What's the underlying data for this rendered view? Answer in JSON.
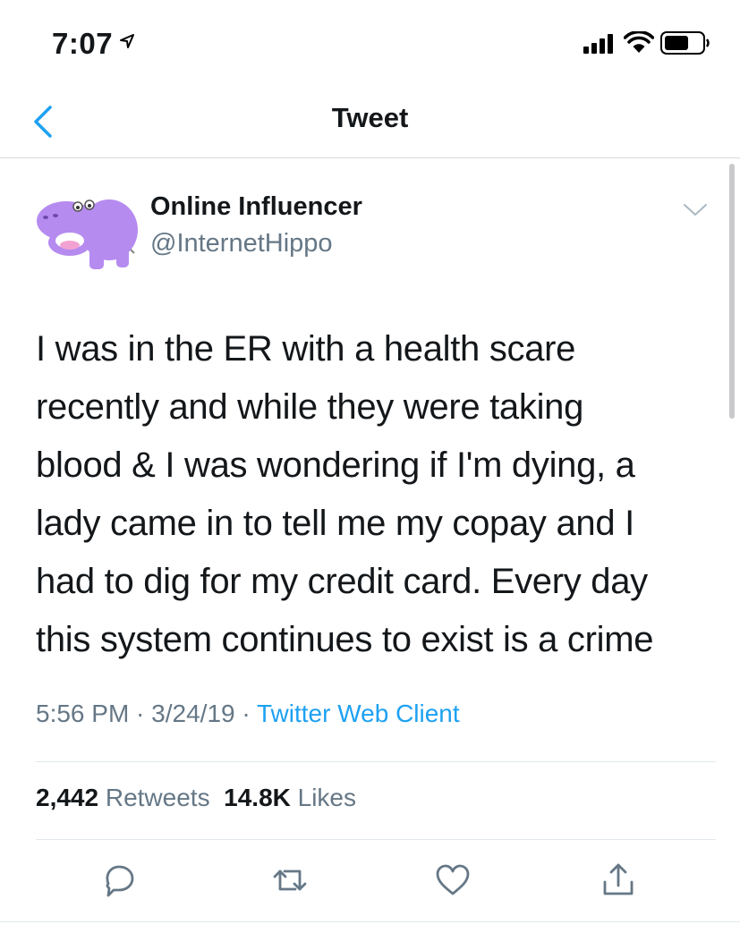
{
  "status_bar": {
    "time": "7:07"
  },
  "nav": {
    "title": "Tweet"
  },
  "author": {
    "name": "Online Influencer",
    "handle": "@InternetHippo"
  },
  "tweet": {
    "text": "I was in the ER with a health scare\nrecently and while they were taking\nblood & I was wondering if I'm dying, a\nlady came in to tell me my copay and I\nhad to dig for my credit card. Every day\nthis system continues to exist is a crime",
    "time": "5:56 PM",
    "date": "3/24/19",
    "source": "Twitter Web Client",
    "separator": " · "
  },
  "stats": {
    "retweets_count": "2,442",
    "retweets_label": "Retweets",
    "likes_count": "14.8K",
    "likes_label": "Likes"
  },
  "icons": {
    "back": "chevron-left-icon",
    "caret": "chevron-down-icon",
    "reply": "reply-icon",
    "retweet": "retweet-icon",
    "like": "heart-icon",
    "share": "share-icon"
  },
  "colors": {
    "accent": "#1da1f2",
    "secondary_text": "#657786",
    "avatar": "#b68bf0"
  }
}
